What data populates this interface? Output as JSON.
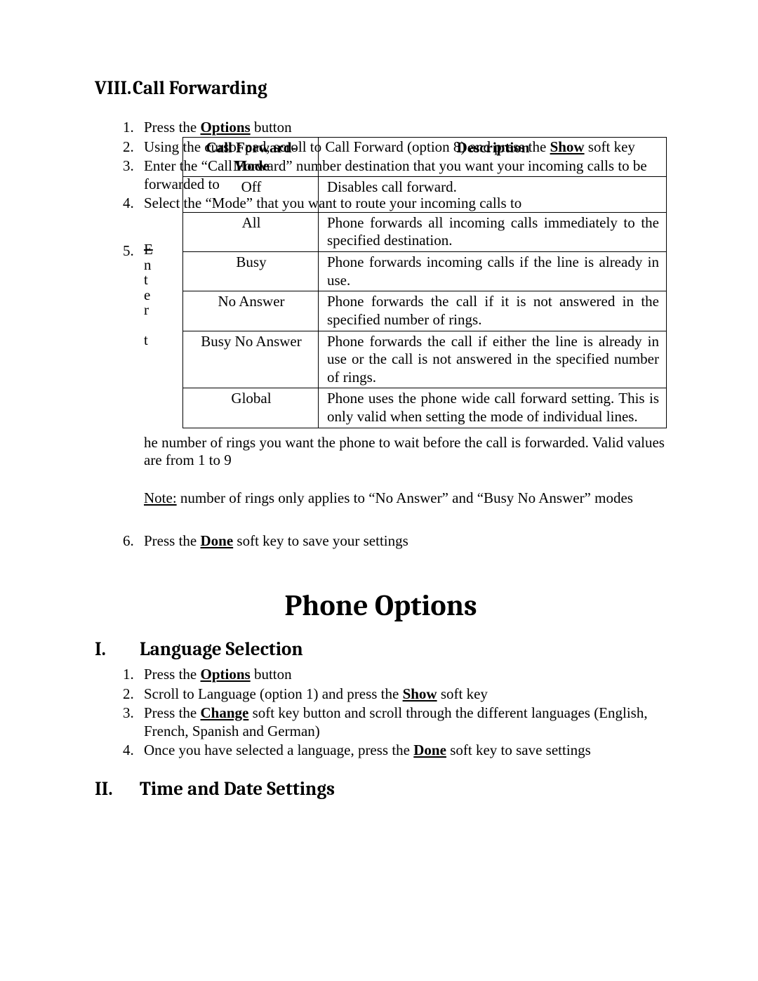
{
  "section_viii": {
    "num": "VIII.",
    "title": "Call Forwarding",
    "steps": {
      "s1": {
        "pre": "Press the ",
        "b": "Options",
        "post": " button"
      },
      "s2": {
        "pre": "Using the cursor pad, scroll to Call Forward (option 8) and press the ",
        "b": "Show",
        "post": " soft key"
      },
      "s3": "Enter the “Call Forward” number destination that you want your incoming calls to be forwarded to",
      "s4": "Select the “Mode” that you want to route your incoming calls to",
      "s5_wrap_letters": [
        "E",
        "n",
        "t",
        "e",
        "r",
        "t"
      ],
      "s5_after": "he number of rings you want the phone to wait before the call is forwarded.  Valid values are from 1 to 9",
      "s5_note_label": "Note:",
      "s5_note": " number of rings only applies to “No Answer” and “Busy No Answer” modes",
      "s6": {
        "pre": "Press the ",
        "b": "Done",
        "post": " soft key to save your settings"
      }
    },
    "table": {
      "h1": "Call Forward-Mode",
      "h2": "Description",
      "rows": [
        {
          "mode": "Off",
          "desc": "Disables call forward."
        },
        {
          "mode": "All",
          "desc": "Phone forwards all incoming calls immediately to the specified destination."
        },
        {
          "mode": "Busy",
          "desc": "Phone forwards incoming calls if the line is already in use."
        },
        {
          "mode": "No Answer",
          "desc": "Phone forwards the call if it is not answered in the specified number of rings."
        },
        {
          "mode": "Busy No Answer",
          "desc": "Phone forwards the call if either the line is already in use or the call is not answered in the specified number of rings."
        },
        {
          "mode": "Global",
          "desc": "Phone uses the phone wide call forward setting.  This is only valid when setting the mode of individual lines."
        }
      ]
    }
  },
  "main_title": "Phone Options",
  "section_i": {
    "num": "I.",
    "title": "Language Selection",
    "steps": {
      "s1": {
        "pre": "Press the ",
        "b": "Options",
        "post": " button"
      },
      "s2": {
        "pre": "Scroll to Language (option 1) and press the ",
        "b": "Show",
        "post": " soft key"
      },
      "s3": {
        "pre": "Press the ",
        "b": "Change",
        "post": " soft key button and scroll through the different languages (English, French, Spanish and German)"
      },
      "s4": {
        "pre": "Once you have selected a language, press the ",
        "b": "Done",
        "post": " soft key to save settings"
      }
    }
  },
  "section_ii": {
    "num": "II.",
    "title": "Time and Date Settings"
  }
}
